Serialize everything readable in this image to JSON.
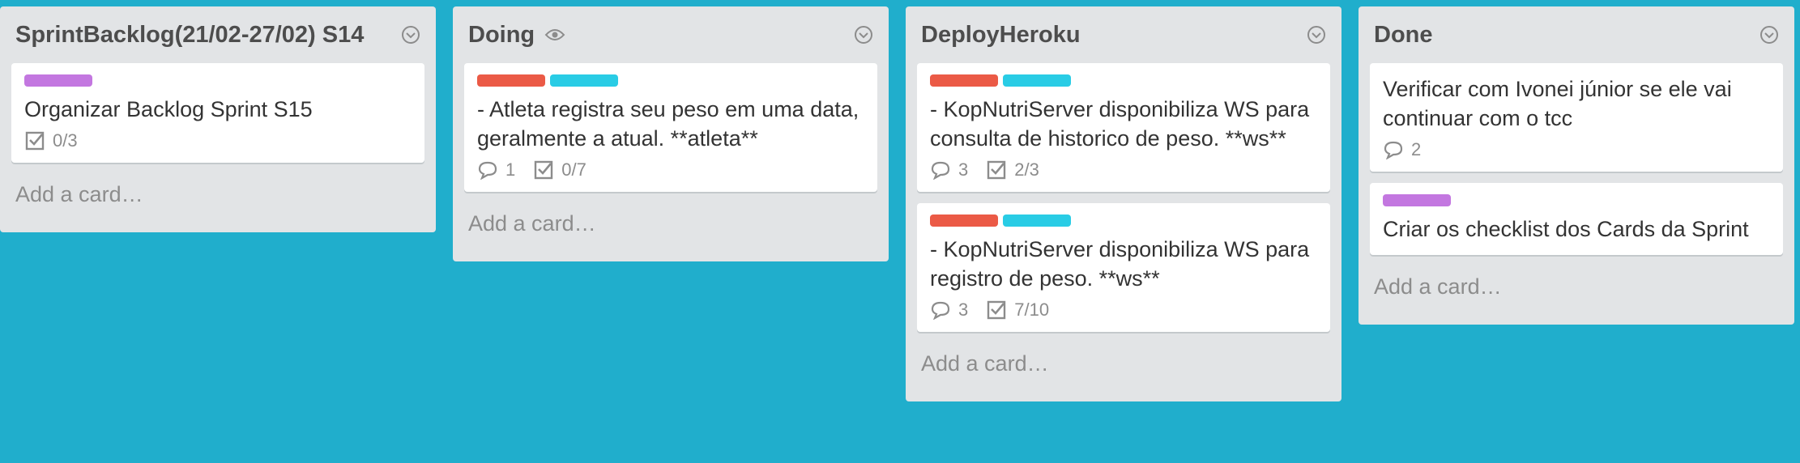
{
  "colors": {
    "board_bg": "#20aecc",
    "list_bg": "#e2e4e6",
    "label_purple": "#c377e0",
    "label_red": "#eb5a46",
    "label_sky": "#29cce5"
  },
  "lists": [
    {
      "title": "SprintBacklog(21/02-27/02) S14",
      "add_card": "Add a card…",
      "cards": [
        {
          "labels": [
            "purple"
          ],
          "title": "Organizar Backlog Sprint S15",
          "checklist": "0/3"
        }
      ]
    },
    {
      "title": "Doing",
      "watch_icon": "eye-icon",
      "add_card": "Add a card…",
      "cards": [
        {
          "labels": [
            "red",
            "sky"
          ],
          "title": "- Atleta registra seu peso em uma data, geralmente a atual. **atleta**",
          "comments": "1",
          "checklist": "0/7"
        }
      ]
    },
    {
      "title": "DeployHeroku",
      "add_card": "Add a card…",
      "cards": [
        {
          "labels": [
            "red",
            "sky"
          ],
          "title": "- KopNutriServer disponibiliza WS para consulta de historico de peso. **ws**",
          "comments": "3",
          "checklist": "2/3"
        },
        {
          "labels": [
            "red",
            "sky"
          ],
          "title": "- KopNutriServer disponibiliza WS para registro de peso. **ws**",
          "comments": "3",
          "checklist": "7/10"
        }
      ]
    },
    {
      "title": "Done",
      "add_card": "Add a card…",
      "cards": [
        {
          "labels": [],
          "title": "Verificar com Ivonei júnior se ele vai continuar com o tcc",
          "comments": "2"
        },
        {
          "labels": [
            "purple"
          ],
          "title": "Criar os checklist dos Cards da Sprint"
        }
      ]
    }
  ]
}
